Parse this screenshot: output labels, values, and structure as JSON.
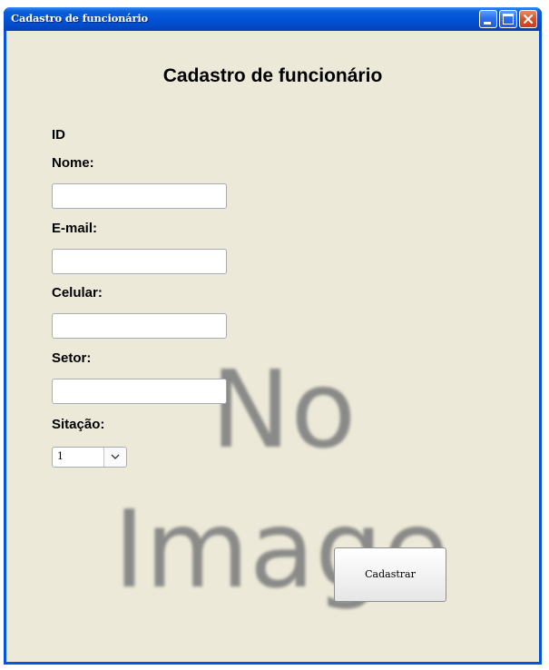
{
  "window": {
    "title": "Cadastro de funcionário",
    "buttons": {
      "minimize_icon": "minimize-icon",
      "maximize_icon": "maximize-icon",
      "close_icon": "close-icon"
    },
    "colors": {
      "titlebar": "#0453d6",
      "client_background": "#ece9d8",
      "close_button": "#d9552f"
    }
  },
  "form": {
    "heading": "Cadastro de funcionário",
    "id_label": "ID",
    "nome_label": "Nome:",
    "nome_value": "",
    "email_label": "E-mail:",
    "email_value": "",
    "celular_label": "Celular:",
    "celular_value": "",
    "setor_label": "Setor:",
    "setor_value": "",
    "situacao_label": "Sitação:",
    "situacao_selected": "1",
    "submit_label": "Cadastrar"
  },
  "background_image": {
    "text_line1": "No",
    "text_line2": "Image"
  }
}
